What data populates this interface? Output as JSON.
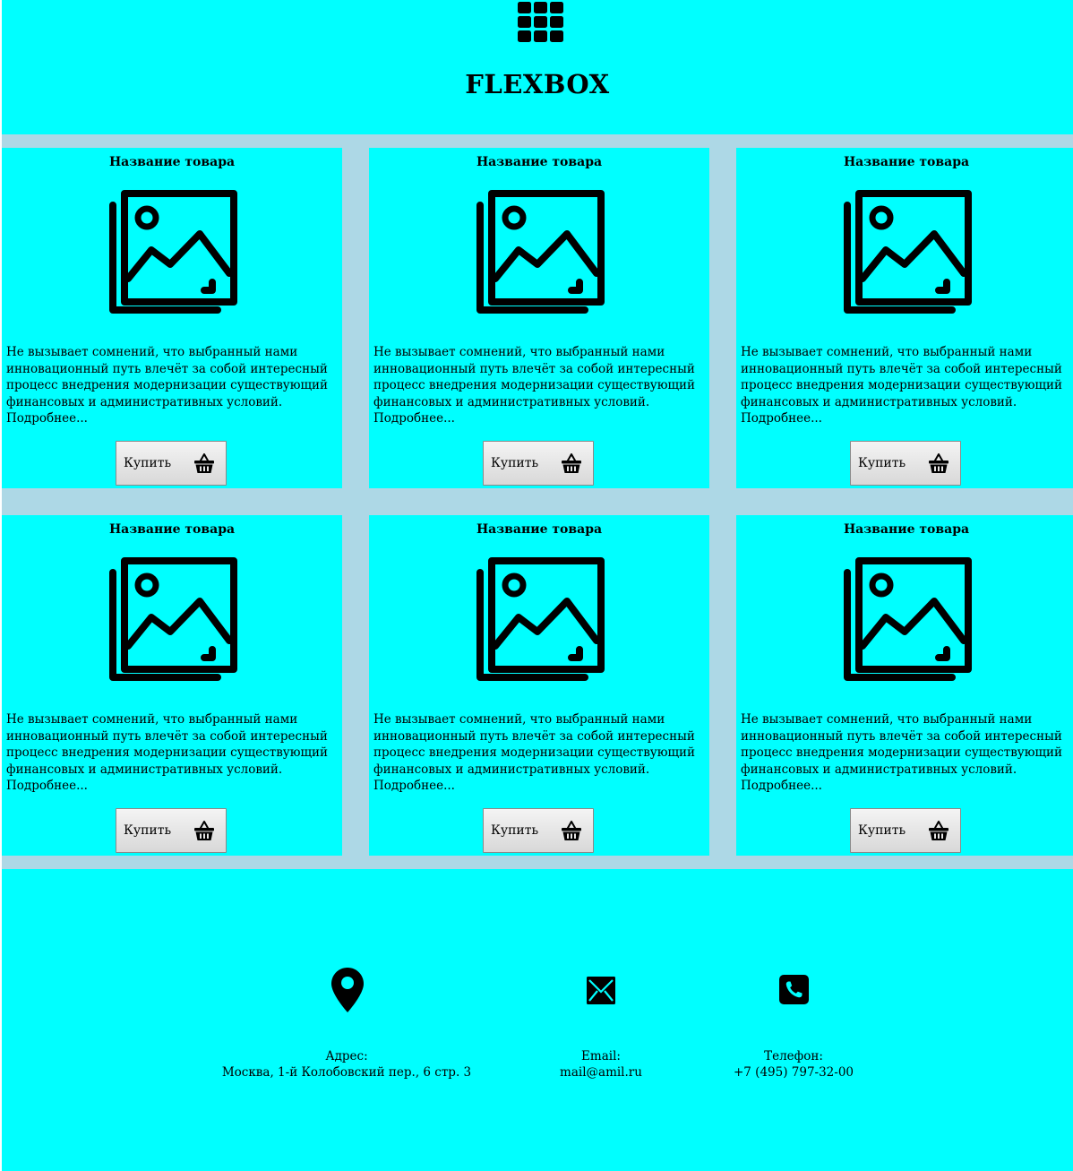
{
  "colors": {
    "panel": "#00ffff",
    "catalog_background": "#add8e6",
    "button_border": "#8a8a8a"
  },
  "header": {
    "icon": "grid-icon",
    "title": "FLEXBOX"
  },
  "products": [
    {
      "title": "Название товара",
      "image_icon": "image-gallery-icon",
      "description": "Не вызывает сомнений, что выбранный нами инновационный путь влечёт за собой интересный процесс внедрения модернизации существующий финансовых и административных условий.",
      "more": "Подробнее...",
      "buy_label": "Купить",
      "buy_icon": "basket-icon"
    },
    {
      "title": "Название товара",
      "image_icon": "image-gallery-icon",
      "description": "Не вызывает сомнений, что выбранный нами инновационный путь влечёт за собой интересный процесс внедрения модернизации существующий финансовых и административных условий.",
      "more": "Подробнее...",
      "buy_label": "Купить",
      "buy_icon": "basket-icon"
    },
    {
      "title": "Название товара",
      "image_icon": "image-gallery-icon",
      "description": "Не вызывает сомнений, что выбранный нами инновационный путь влечёт за собой интересный процесс внедрения модернизации существующий финансовых и административных условий.",
      "more": "Подробнее...",
      "buy_label": "Купить",
      "buy_icon": "basket-icon"
    },
    {
      "title": "Название товара",
      "image_icon": "image-gallery-icon",
      "description": "Не вызывает сомнений, что выбранный нами инновационный путь влечёт за собой интересный процесс внедрения модернизации существующий финансовых и административных условий.",
      "more": "Подробнее...",
      "buy_label": "Купить",
      "buy_icon": "basket-icon"
    },
    {
      "title": "Название товара",
      "image_icon": "image-gallery-icon",
      "description": "Не вызывает сомнений, что выбранный нами инновационный путь влечёт за собой интересный процесс внедрения модернизации существующий финансовых и административных условий.",
      "more": "Подробнее...",
      "buy_label": "Купить",
      "buy_icon": "basket-icon"
    },
    {
      "title": "Название товара",
      "image_icon": "image-gallery-icon",
      "description": "Не вызывает сомнений, что выбранный нами инновационный путь влечёт за собой интересный процесс внедрения модернизации существующий финансовых и административных условий.",
      "more": "Подробнее...",
      "buy_label": "Купить",
      "buy_icon": "basket-icon"
    }
  ],
  "footer": {
    "address": {
      "icon": "location-pin-icon",
      "label": "Адрес:",
      "value": "Москва, 1-й Колобовский пер., 6 стр. 3"
    },
    "email": {
      "icon": "envelope-icon",
      "label": "Email:",
      "value": "mail@amil.ru"
    },
    "phone": {
      "icon": "phone-icon",
      "label": "Телефон:",
      "value": "+7 (495) 797-32-00"
    }
  }
}
